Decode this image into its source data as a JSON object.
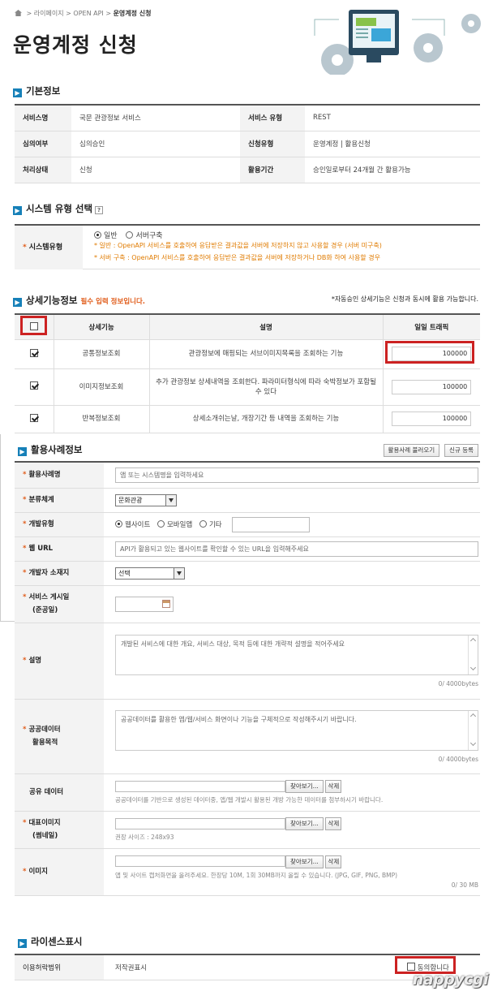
{
  "breadcrumb": {
    "home": "라이페이지",
    "sep": ">",
    "level1": "OPEN API",
    "current": "운영계정 신청"
  },
  "page_title": "운영계정 신청",
  "basic": {
    "heading": "기본정보",
    "rows": [
      [
        {
          "h": "서비스명",
          "v": "국문 관광정보 서비스"
        },
        {
          "h": "서비스 유형",
          "v": "REST"
        }
      ],
      [
        {
          "h": "심의여부",
          "v": "심의승인"
        },
        {
          "h": "신청유형",
          "v": "운영계정 | 활용신청"
        }
      ],
      [
        {
          "h": "처리상태",
          "v": "신청"
        },
        {
          "h": "활용기간",
          "v": "승인일로부터 24개월 간 활용가능"
        }
      ]
    ]
  },
  "system": {
    "heading": "시스템 유형 선택",
    "help": "?",
    "label": "시스템유형",
    "options": [
      "일반",
      "서버구축"
    ],
    "selected": 0,
    "notes": [
      "* 일반 : OpenAPI 서비스를 호출하여 응답받은 결과값을 서버에 저장하지 않고 사용할 경우 (서버 미구축)",
      "* 서버 구축 : OpenAPI 서비스를 호출하여 응답받은 결과값을 서버에 저장하거나 DB화 하여 사용할 경우"
    ]
  },
  "detail": {
    "heading": "상세기능정보",
    "required": "필수 입력 정보입니다.",
    "note": "*자동승인 상세기능은 신청과 동시에 활용 가능합니다.",
    "columns": [
      "상세기능",
      "설명",
      "일일 트래픽"
    ],
    "rows": [
      {
        "name": "공통정보조회",
        "desc": "관광정보에 매핑되는 서브이미지목록을 조회하는 기능",
        "traffic": "100000",
        "checked": true
      },
      {
        "name": "이미지정보조회",
        "desc": "추가 관광정보 상세내역을 조회한다. 파라미터형식에 따라 숙박정보가 포함될 수 있다",
        "traffic": "100000",
        "checked": true
      },
      {
        "name": "반복정보조회",
        "desc": "상세소개쉬는날, 개장기간 등 내역을 조회하는 기능",
        "traffic": "100000",
        "checked": true
      }
    ]
  },
  "usage": {
    "heading": "활용사례정보",
    "btn_load": "활용사례 불러오기",
    "btn_new": "신규 등록",
    "fields": {
      "case_name": {
        "label": "활용사례명",
        "placeholder": "앱 또는 시스템명을 입력하세요"
      },
      "category": {
        "label": "분류체계",
        "value": "문화관광"
      },
      "dev_type": {
        "label": "개발유형",
        "options": [
          "웹사이트",
          "모바일앱",
          "기타"
        ],
        "selected": 0
      },
      "web_url": {
        "label": "웹 URL",
        "placeholder": "API가 활용되고 있는 웹사이트를 확인할 수 있는 URL을 입력해주세요"
      },
      "developer": {
        "label": "개발자 소재지",
        "value": "선택"
      },
      "publish": {
        "label": "서비스 게시일",
        "label2": "(준공일)"
      },
      "desc": {
        "label": "설명",
        "placeholder": "개발된 서비스에 대한 개요, 서비스 대상, 목적 등에 대한 개략적 설명을 적어주세요",
        "count": "0/ 4000bytes"
      },
      "purpose": {
        "label": "공공데이터",
        "label2": "활용목적",
        "placeholder": "공공데이터를 활용한 앱/웹/서비스 화면이나 기능을 구체적으로 작성해주시기 바랍니다.",
        "count": "0/ 4000bytes"
      },
      "share": {
        "label": "공유 데이터",
        "hint": "공공데이터를 기반으로 생성된 데이터중, 앱/웹 개발시 활용된 개방 가능한 데이터를 첨부하시기 바랍니다."
      },
      "rep_image": {
        "label": "대표이미지",
        "label2": "(썸네일)",
        "hint": "권장 사이즈 : 248x93"
      },
      "image": {
        "label": "이미지",
        "hint": "앱 및 사이트 캡처화면을 올려주세요. 한장당 10M, 1회 30MB까지 올릴 수 있습니다. (JPG, GIF, PNG, BMP)",
        "count": "0/ 30 MB"
      }
    },
    "browse": "찾아보기...",
    "delete": "삭제"
  },
  "license": {
    "heading": "라이센스표시",
    "label": "이용허락범위",
    "value": "저작권표시",
    "agree": "동의합니다"
  },
  "watermark": "nappycgi",
  "colors": {
    "accent": "#1680b8",
    "required": "#e05c1a",
    "highlight": "#cc2222"
  }
}
